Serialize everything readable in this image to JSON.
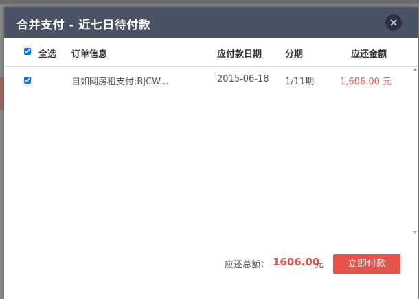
{
  "dialog": {
    "title": "合并支付 - 近七日待付款",
    "close_symbol": "×"
  },
  "table": {
    "headers": {
      "select_all": "全选",
      "order_info": "订单信息",
      "due_date": "应付款日期",
      "installment": "分期",
      "amount": "应还金额"
    },
    "rows": [
      {
        "checked": true,
        "order_info": "自如网房租支付:BJCW...",
        "due_date": "2015-06-18",
        "installment": "1/11期",
        "amount": "1,606.00 元"
      }
    ]
  },
  "footer": {
    "total_label": "应还总额：",
    "total_value": "1606.00",
    "total_unit": "元",
    "pay_button": "立即付款"
  },
  "colors": {
    "header_bg": "#4a5366",
    "accent_red": "#e5534b"
  },
  "icons": {
    "close": "close-icon"
  }
}
